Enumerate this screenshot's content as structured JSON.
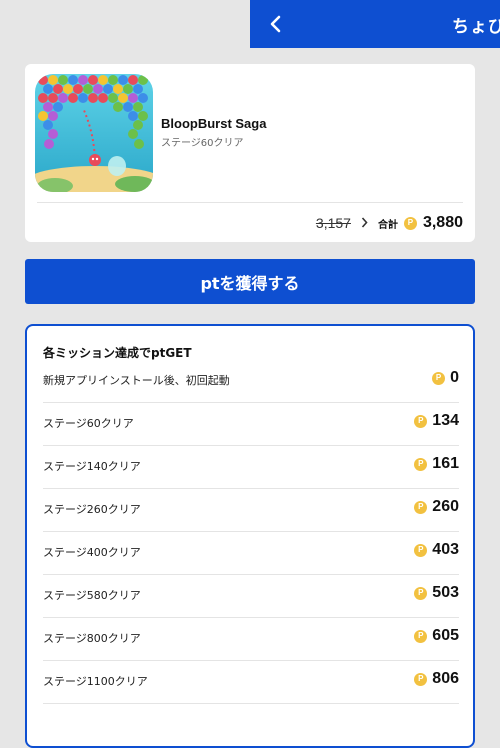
{
  "header": {
    "title": "ちょびリッチ"
  },
  "app": {
    "name": "BloopBurst Saga",
    "subtitle": "ステージ60クリア",
    "old_price": "3,157",
    "total_label": "合計",
    "total_value": "3,880"
  },
  "cta": {
    "label": "ptを獲得する"
  },
  "missions": {
    "heading": "各ミッション達成でptGET",
    "coin_symbol": "P",
    "items": [
      {
        "label": "新規アプリインストール後、初回起動",
        "points": "0"
      },
      {
        "label": "ステージ60クリア",
        "points": "134"
      },
      {
        "label": "ステージ140クリア",
        "points": "161"
      },
      {
        "label": "ステージ260クリア",
        "points": "260"
      },
      {
        "label": "ステージ400クリア",
        "points": "403"
      },
      {
        "label": "ステージ580クリア",
        "points": "503"
      },
      {
        "label": "ステージ800クリア",
        "points": "605"
      },
      {
        "label": "ステージ1100クリア",
        "points": "806"
      }
    ]
  },
  "colors": {
    "brand": "#0e4fd1",
    "coin": "#f2c140",
    "background": "#e6e6e6"
  }
}
